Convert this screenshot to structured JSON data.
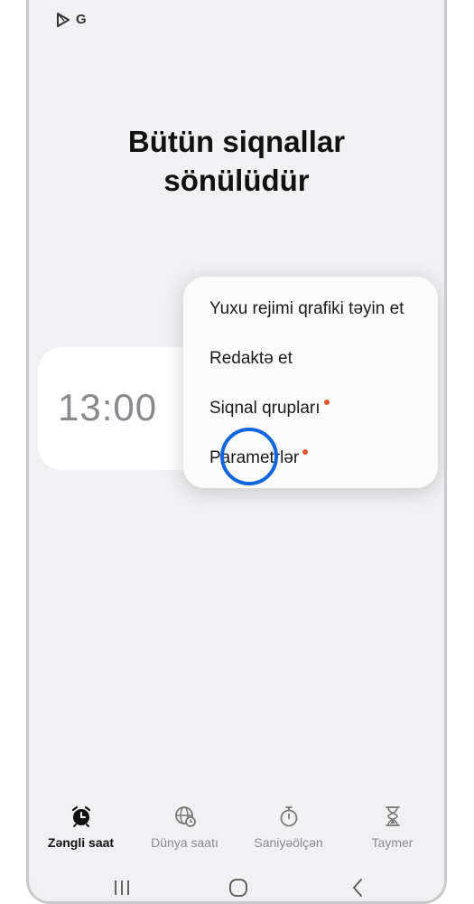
{
  "status_bar": {
    "icons": [
      "play-store-icon",
      "google-icon"
    ],
    "google_letter": "G"
  },
  "headline": {
    "line1": "Bütün siqnallar",
    "line2": "sönülüdür"
  },
  "alarm": {
    "time": "13:00"
  },
  "menu": {
    "items": [
      {
        "label": "Yuxu rejimi qrafiki təyin et",
        "badge": false
      },
      {
        "label": "Redaktə et",
        "badge": false
      },
      {
        "label": "Siqnal qrupları",
        "badge": true
      },
      {
        "label": "Parametrlər",
        "badge": true
      }
    ]
  },
  "bottom_nav": {
    "tabs": [
      {
        "label": "Zəngli saat",
        "icon": "alarm-clock-icon",
        "active": true
      },
      {
        "label": "Dünya saatı",
        "icon": "globe-clock-icon",
        "active": false
      },
      {
        "label": "Saniyəölçən",
        "icon": "stopwatch-icon",
        "active": false
      },
      {
        "label": "Taymer",
        "icon": "hourglass-icon",
        "active": false
      }
    ]
  },
  "system_nav": [
    "recents-icon",
    "home-icon",
    "back-icon"
  ],
  "colors": {
    "background": "#f1f1f3",
    "badge": "#e2572a",
    "tap_indicator": "#1166dd"
  }
}
